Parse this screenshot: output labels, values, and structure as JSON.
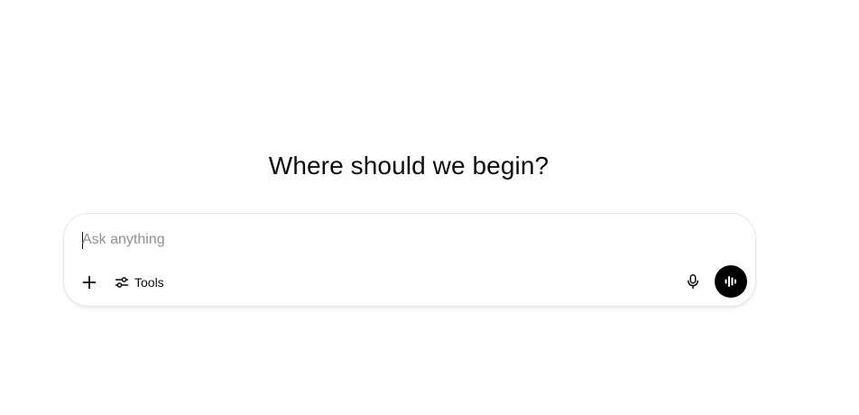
{
  "main": {
    "heading": "Where should we begin?"
  },
  "composer": {
    "placeholder": "Ask anything",
    "value": "",
    "attach_icon": "plus-icon",
    "tools_icon": "sliders-icon",
    "tools_label": "Tools",
    "dictate_icon": "microphone-icon",
    "voice_icon": "voice-waveform-icon"
  },
  "colors": {
    "text": "#0d0d0d",
    "placeholder": "#8f8f8f",
    "voice_button": "#000000",
    "border": "#e6e6e6"
  }
}
